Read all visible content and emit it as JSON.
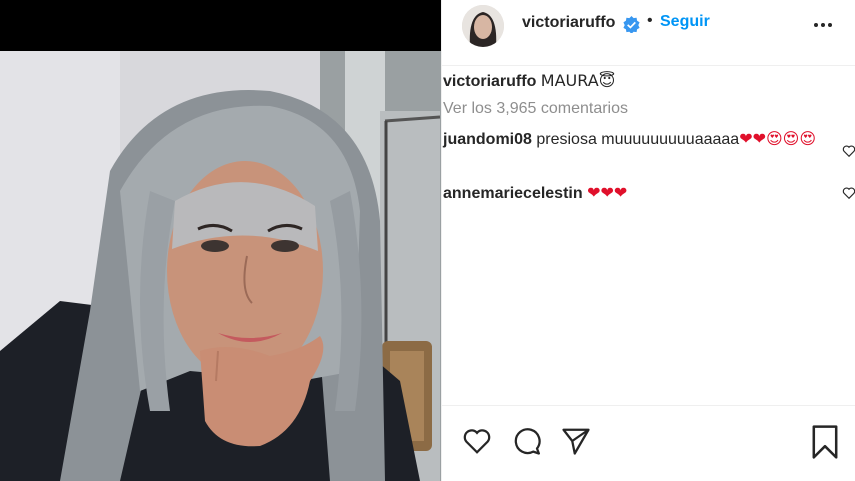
{
  "post": {
    "username": "victoriaruffo",
    "follow_label": "Seguir",
    "dot": "•",
    "caption_user": "victoriaruffo",
    "caption_text": "MAURA😇",
    "view_all_label": "Ver los 3,965 comentarios"
  },
  "comments": [
    {
      "user": "juandomi08",
      "text": "presiosa muuuuuuuuuaaaaa",
      "emoji": "❤❤😍😍😍"
    },
    {
      "user": "annemariecelestin",
      "text": "",
      "emoji": "❤❤❤"
    }
  ],
  "icons": [
    "verified-icon",
    "more-options-icon",
    "like-icon",
    "comment-icon",
    "share-icon",
    "save-icon",
    "comment-like-icon"
  ],
  "colors": {
    "link": "#0095f6",
    "verified": "#3897f0",
    "muted": "#8e8e8e",
    "text": "#262626"
  }
}
